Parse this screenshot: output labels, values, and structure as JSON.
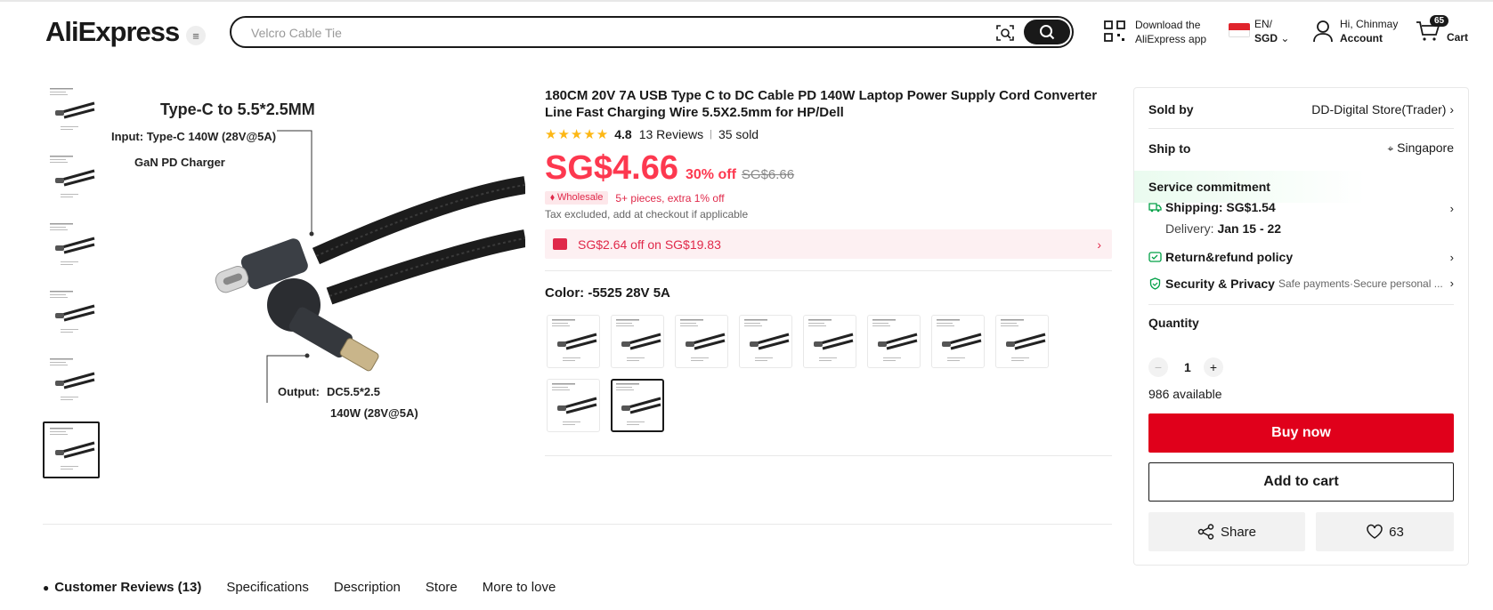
{
  "header": {
    "logo": "AliExpress",
    "search_placeholder": "Velcro Cable Tie",
    "download_line1": "Download the",
    "download_line2": "AliExpress app",
    "lang": "EN/",
    "currency": "SGD",
    "greeting": "Hi, Chinmay",
    "account": "Account",
    "cart_count": "65",
    "cart": "Cart"
  },
  "image": {
    "headline": "Type-C to 5.5*2.5MM",
    "input_label": "Input: Type-C 140W (28V@5A)",
    "charger_label": "GaN PD Charger",
    "output_label": "Output:",
    "output_spec": "DC5.5*2.5",
    "output_power": "140W (28V@5A)"
  },
  "product": {
    "title": "180CM 20V 7A USB Type C to DC Cable PD 140W Laptop Power Supply Cord Converter Line Fast Charging Wire 5.5X2.5mm for HP/Dell",
    "rating": "4.8",
    "reviews": "13 Reviews",
    "divider": "|",
    "sold": "35 sold",
    "price": "SG$4.66",
    "discount": "30% off",
    "original_price": "SG$6.66",
    "wholesale_tag": "Wholesale",
    "wholesale_text": "5+ pieces, extra 1% off",
    "tax_note": "Tax excluded, add at checkout if applicable",
    "coupon": "SG$2.64 off on SG$19.83",
    "color_label": "Color: -5525 28V 5A"
  },
  "panel": {
    "sold_by_label": "Sold by",
    "store": "DD-Digital Store(Trader)",
    "ship_to_label": "Ship to",
    "ship_to": "Singapore",
    "service_title": "Service commitment",
    "shipping": "Shipping: SG$1.54",
    "delivery_label": "Delivery:",
    "delivery": "Jan 15 - 22",
    "return_policy": "Return&refund policy",
    "security": "Security & Privacy",
    "security_note": "Safe payments·Secure personal ...",
    "quantity_label": "Quantity",
    "minus": "−",
    "quantity": "1",
    "plus": "+",
    "available": "986 available",
    "buy_now": "Buy now",
    "add_to_cart": "Add to cart",
    "share": "Share",
    "wishlist_count": "63"
  },
  "tabs": [
    "Customer Reviews (13)",
    "Specifications",
    "Description",
    "Store",
    "More to love"
  ],
  "colors": {
    "accent": "#fd384f",
    "buy": "#e0001b",
    "star": "#fdb714",
    "dark": "#191919"
  }
}
